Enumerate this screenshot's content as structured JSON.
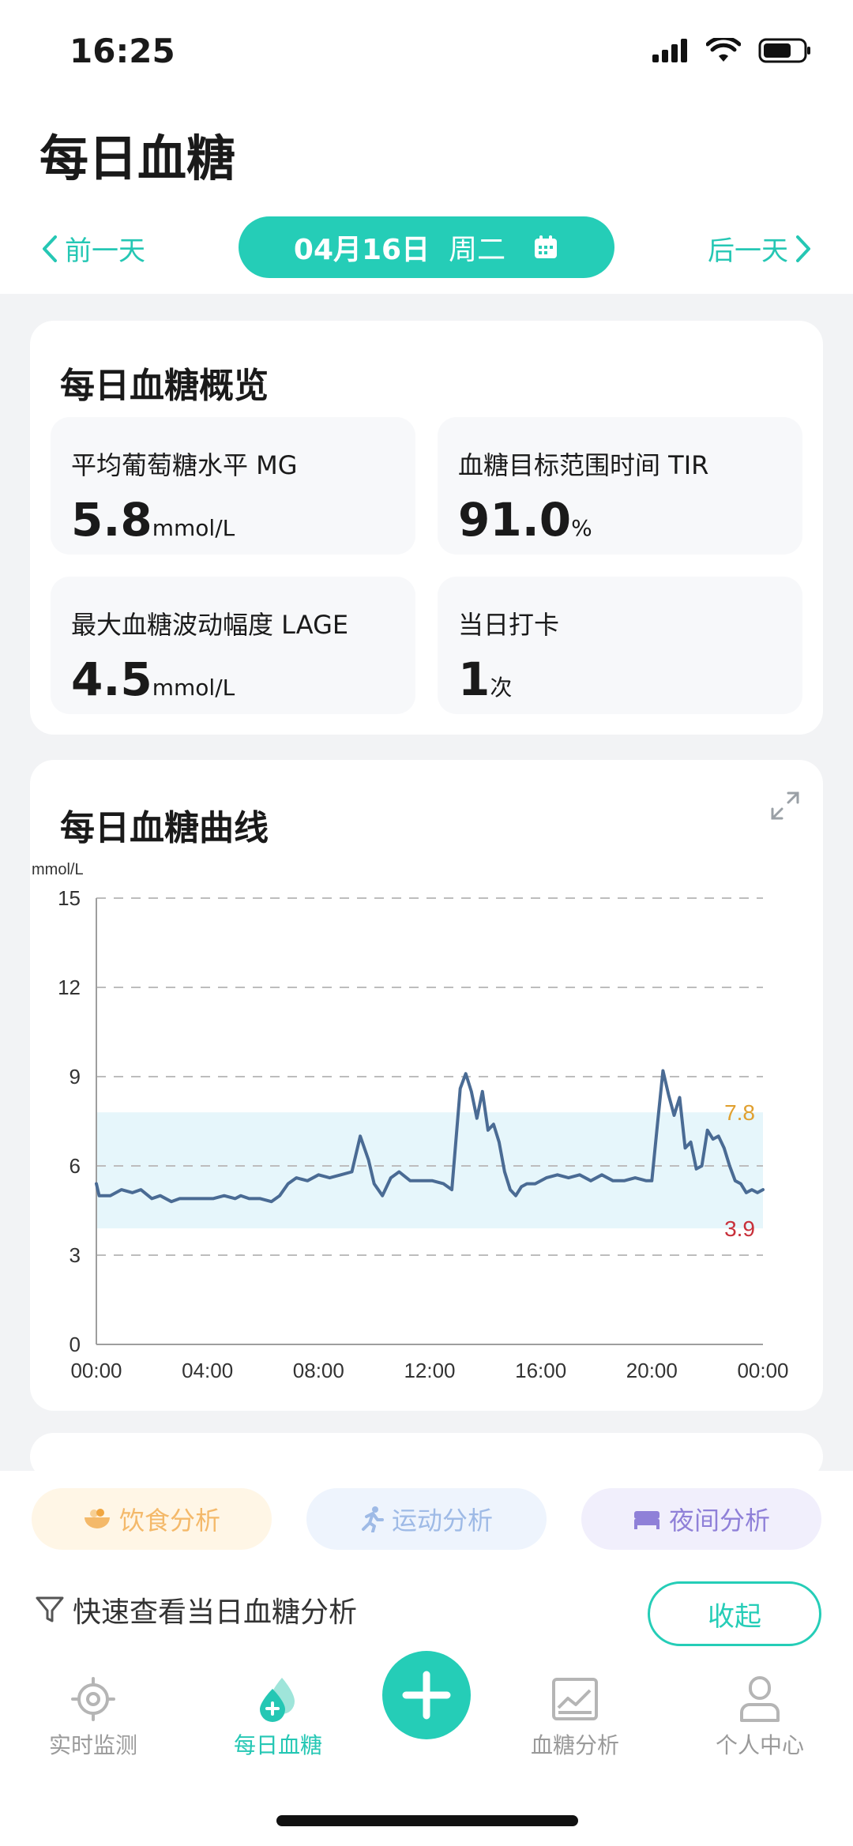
{
  "status_bar": {
    "time": "16:25"
  },
  "header": {
    "title": "每日血糖"
  },
  "date_nav": {
    "prev": "前一天",
    "date": "04月16日",
    "weekday": "周二",
    "next": "后一天"
  },
  "overview": {
    "title": "每日血糖概览",
    "metrics": [
      {
        "label": "平均葡萄糖水平  MG",
        "value": "5.8",
        "unit": "mmol/L"
      },
      {
        "label": "血糖目标范围时间  TIR",
        "value": "91.0",
        "unit": "%"
      },
      {
        "label": "最大血糖波动幅度  LAGE",
        "value": "4.5",
        "unit": "mmol/L"
      },
      {
        "label": "当日打卡",
        "value": "1",
        "unit": "次"
      }
    ]
  },
  "chart": {
    "title": "每日血糖曲线",
    "icon": "expand-icon"
  },
  "chart_data": {
    "type": "line",
    "ylabel": "mmol/L",
    "ylim": [
      0,
      15
    ],
    "yticks": [
      "0",
      "3",
      "6",
      "9",
      "12",
      "15"
    ],
    "xticks": [
      "00:00",
      "04:00",
      "08:00",
      "12:00",
      "16:00",
      "20:00",
      "00:00"
    ],
    "xlim": [
      0,
      24
    ],
    "target_range": [
      3.9,
      7.8
    ],
    "reference_lines": [
      {
        "label": "7.8",
        "value": 7.8,
        "color": "#e0a030"
      },
      {
        "label": "3.9",
        "value": 3.9,
        "color": "#c8303a"
      }
    ],
    "grid": true,
    "series": [
      {
        "color": "#4a6b94",
        "x": [
          0,
          0.1,
          0.5,
          0.9,
          1.3,
          1.6,
          2.0,
          2.3,
          2.7,
          3.0,
          3.4,
          3.8,
          4.2,
          4.6,
          5.0,
          5.2,
          5.5,
          5.9,
          6.3,
          6.6,
          6.9,
          7.2,
          7.6,
          8.0,
          8.4,
          8.8,
          9.2,
          9.5,
          9.8,
          10.0,
          10.3,
          10.6,
          10.9,
          11.3,
          11.7,
          12.1,
          12.5,
          12.8,
          13.1,
          13.3,
          13.5,
          13.7,
          13.9,
          14.1,
          14.3,
          14.5,
          14.7,
          14.9,
          15.1,
          15.3,
          15.5,
          15.8,
          16.2,
          16.6,
          17.0,
          17.4,
          17.8,
          18.2,
          18.6,
          19.0,
          19.4,
          19.8,
          20.0,
          20.2,
          20.4,
          20.6,
          20.8,
          21.0,
          21.2,
          21.4,
          21.6,
          21.8,
          22.0,
          22.2,
          22.4,
          22.6,
          22.8,
          23.0,
          23.2,
          23.4,
          23.6,
          23.8,
          24.0
        ],
        "y": [
          5.4,
          5.0,
          5.0,
          5.2,
          5.1,
          5.2,
          4.9,
          5.0,
          4.8,
          4.9,
          4.9,
          4.9,
          4.9,
          5.0,
          4.9,
          5.0,
          4.9,
          4.9,
          4.8,
          5.0,
          5.4,
          5.6,
          5.5,
          5.7,
          5.6,
          5.7,
          5.8,
          7.0,
          6.2,
          5.4,
          5.0,
          5.6,
          5.8,
          5.5,
          5.5,
          5.5,
          5.4,
          5.2,
          8.6,
          9.1,
          8.5,
          7.6,
          8.5,
          7.2,
          7.4,
          6.8,
          5.8,
          5.2,
          5.0,
          5.3,
          5.4,
          5.4,
          5.6,
          5.7,
          5.6,
          5.7,
          5.5,
          5.7,
          5.5,
          5.5,
          5.6,
          5.5,
          5.5,
          7.4,
          9.2,
          8.4,
          7.7,
          8.3,
          6.6,
          6.8,
          5.9,
          6.0,
          7.2,
          6.9,
          7.0,
          6.6,
          6.0,
          5.5,
          5.4,
          5.1,
          5.2,
          5.1,
          5.2
        ]
      }
    ]
  },
  "analysis_chips": [
    {
      "label": "饮食分析",
      "icon": "food-bowl-icon"
    },
    {
      "label": "运动分析",
      "icon": "running-icon"
    },
    {
      "label": "夜间分析",
      "icon": "bed-icon"
    }
  ],
  "quick_view": {
    "label": "快速查看当日血糖分析",
    "icon": "filter-icon",
    "collapse": "收起"
  },
  "tabbar": {
    "items": [
      {
        "label": "实时监测",
        "icon": "target-icon"
      },
      {
        "label": "每日血糖",
        "icon": "blood-drop-icon"
      },
      {
        "label": "血糖分析",
        "icon": "chart-icon"
      },
      {
        "label": "个人中心",
        "icon": "user-icon"
      }
    ],
    "fab_icon": "plus-icon"
  },
  "colors": {
    "accent": "#25cdb7",
    "line": "#4a6b94",
    "target_band": "#e6f6fb"
  }
}
